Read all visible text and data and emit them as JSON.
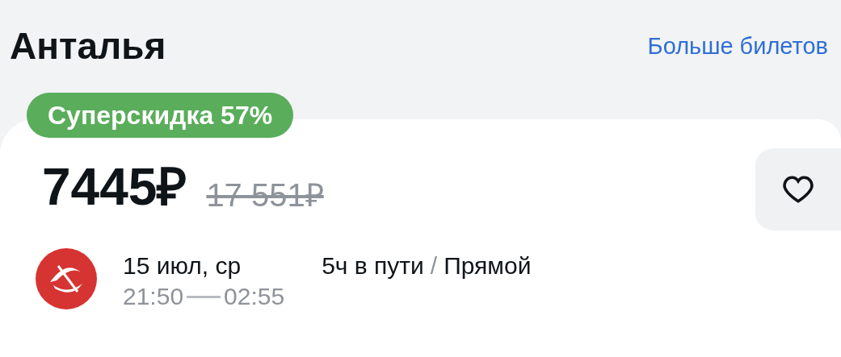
{
  "header": {
    "title": "Анталья",
    "link": "Больше билетов"
  },
  "offer": {
    "badge": "Суперскидка 57%",
    "price": "7445₽",
    "old_price": "17 551₽",
    "favorite": false,
    "flight": {
      "date": "15 июл, ср",
      "departure": "21:50",
      "arrival": "02:55",
      "duration": "5ч в пути",
      "separator": "/",
      "type": "Прямой"
    }
  }
}
